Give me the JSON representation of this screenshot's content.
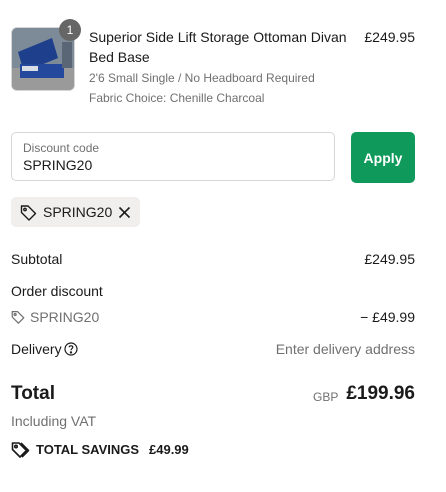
{
  "product": {
    "quantity": "1",
    "title": "Superior Side Lift Storage Ottoman Divan Bed Base",
    "price": "£249.95",
    "variant_size": "2'6 Small Single / No Headboard Required",
    "variant_fabric": "Fabric Choice: Chenille Charcoal"
  },
  "discount": {
    "field_label": "Discount code",
    "field_value": "SPRING20",
    "apply_label": "Apply",
    "applied_code": "SPRING20"
  },
  "summary": {
    "subtotal_label": "Subtotal",
    "subtotal_value": "£249.95",
    "order_discount_label": "Order discount",
    "discount_code": "SPRING20",
    "discount_value": "− £49.99",
    "delivery_label": "Delivery",
    "delivery_value": "Enter delivery address",
    "total_label": "Total",
    "currency": "GBP",
    "total_value": "£199.96",
    "vat_note": "Including VAT",
    "savings_label": "TOTAL SAVINGS",
    "savings_value": "£49.99"
  },
  "colors": {
    "accent": "#0f9a5c",
    "muted_text": "#707070",
    "chip_bg": "#f1eeee"
  },
  "icons": [
    "tag-icon",
    "close-icon",
    "help-circle-icon",
    "savings-tag-icon"
  ]
}
